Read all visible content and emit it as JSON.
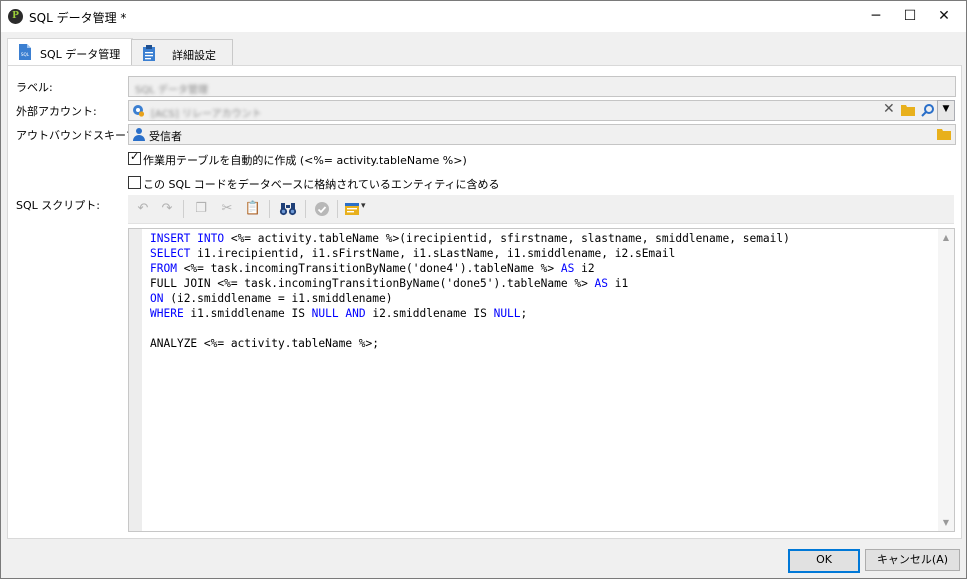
{
  "window": {
    "title": "SQL データ管理 *",
    "minimize_glyph": "─",
    "maximize_glyph": "☐",
    "close_glyph": "✕"
  },
  "tabs": [
    {
      "label": "SQL データ管理",
      "active": true,
      "icon": "sql-file-icon"
    },
    {
      "label": "詳細設定",
      "active": false,
      "icon": "clipboard-icon"
    }
  ],
  "form": {
    "label_caption": "ラベル:",
    "label_value": "SQL データ管理",
    "external_account_caption": "外部アカウント:",
    "external_account_value": "[ACS] リレーアカウント",
    "outbound_schema_caption": "アウトバウンドスキーマ:",
    "outbound_schema_value": "受信者",
    "create_work_table_label": "作業用テーブルを自動的に作成 (<%= activity.tableName %>)",
    "create_work_table_checked": true,
    "include_entity_label": "この SQL コードをデータベースに格納されているエンティティに含める",
    "include_entity_checked": false,
    "sql_script_caption": "SQL スクリプト:"
  },
  "toolbar": {
    "undo_glyph": "↶",
    "redo_glyph": "↷",
    "copy_glyph": "❐",
    "cut_glyph": "✂",
    "paste_glyph": "📋",
    "find_glyph": "🔍",
    "validate_glyph": "✔",
    "insert_glyph": "▾"
  },
  "sql_lines": [
    [
      {
        "t": "INSERT INTO",
        "k": 1
      },
      {
        "t": " <%= activity.tableName %>(irecipientid, sfirstname, slastname, smiddlename, semail)",
        "k": 0
      }
    ],
    [
      {
        "t": "SELECT",
        "k": 1
      },
      {
        "t": " i1.irecipientid, i1.sFirstName, i1.sLastName, i1.smiddlename, i2.sEmail",
        "k": 0
      }
    ],
    [
      {
        "t": "FROM",
        "k": 1
      },
      {
        "t": " <%= task.incomingTransitionByName('done4').tableName %> ",
        "k": 0
      },
      {
        "t": "AS",
        "k": 1
      },
      {
        "t": " i2",
        "k": 0
      }
    ],
    [
      {
        "t": "FULL JOIN <%= task.incomingTransitionByName('done5').tableName %> ",
        "k": 0
      },
      {
        "t": "AS",
        "k": 1
      },
      {
        "t": " i1",
        "k": 0
      }
    ],
    [
      {
        "t": "ON",
        "k": 1
      },
      {
        "t": " (i2.smiddlename = i1.smiddlename)",
        "k": 0
      }
    ],
    [
      {
        "t": "WHERE",
        "k": 1
      },
      {
        "t": " i1.smiddlename IS ",
        "k": 0
      },
      {
        "t": "NULL",
        "k": 1
      },
      {
        "t": " ",
        "k": 0
      },
      {
        "t": "AND",
        "k": 1
      },
      {
        "t": " i2.smiddlename IS ",
        "k": 0
      },
      {
        "t": "NULL",
        "k": 1
      },
      {
        "t": ";",
        "k": 0
      }
    ],
    [],
    [
      {
        "t": "ANALYZE <%= activity.tableName %>;",
        "k": 0
      }
    ]
  ],
  "buttons": {
    "ok": "OK",
    "cancel": "キャンセル(A)"
  },
  "colors": {
    "keyword": "#0000ff",
    "accent": "#0078d7"
  }
}
